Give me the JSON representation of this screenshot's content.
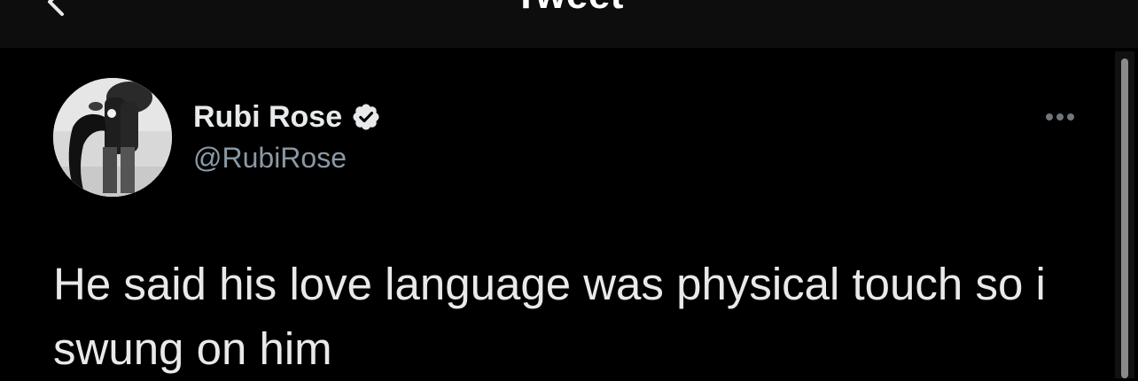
{
  "header": {
    "title": "Tweet",
    "back_icon": "chevron-left-icon"
  },
  "tweet": {
    "author": {
      "display_name": "Rubi Rose",
      "handle": "@RubiRose",
      "verified": true,
      "verified_icon": "verified-badge-icon",
      "avatar_icon": "avatar-photo"
    },
    "more_icon": "more-options-icon",
    "text": "He said his love language was physical touch so i swung on him"
  },
  "colors": {
    "background": "#000000",
    "header_background": "#0d0d0d",
    "primary_text": "#e7e9ea",
    "secondary_text": "#8b98a5",
    "badge": "#e7e9ea"
  }
}
